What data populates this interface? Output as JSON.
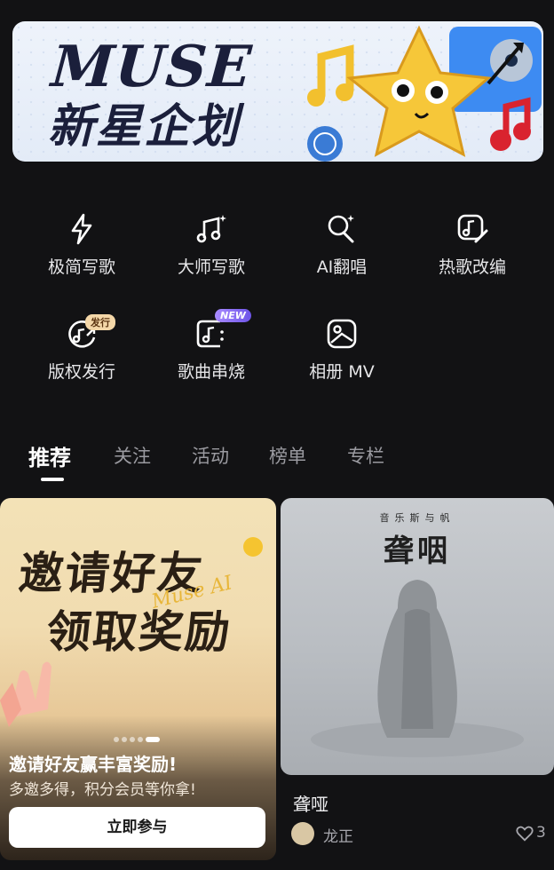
{
  "banner": {
    "title": "MUSE",
    "subtitle": "新星企划"
  },
  "tools": [
    {
      "label": "极简写歌",
      "icon": "lightning-icon"
    },
    {
      "label": "大师写歌",
      "icon": "music-note-icon"
    },
    {
      "label": "AI翻唱",
      "icon": "microphone-icon"
    },
    {
      "label": "热歌改编",
      "icon": "music-edit-icon"
    },
    {
      "label": "版权发行",
      "icon": "copyright-release-icon",
      "badge": "发行"
    },
    {
      "label": "歌曲串烧",
      "icon": "music-medley-icon",
      "badge": "NEW"
    },
    {
      "label": "相册 MV",
      "icon": "photo-mv-icon"
    }
  ],
  "tabs": [
    "推荐",
    "关注",
    "活动",
    "榜单",
    "专栏"
  ],
  "active_tab": "推荐",
  "promo_card": {
    "headline_line1": "邀请好友",
    "headline_line2": "领取奖励",
    "brand_script": "Muse AI",
    "title": "邀请好友赢丰富奖励!",
    "subtitle": "多邀多得，积分会员等你拿!",
    "button": "立即参与",
    "carousel_count": 5,
    "carousel_active": 5
  },
  "song_card": {
    "cover_small": "音乐斯与帆",
    "cover_title": "聋咽",
    "title": "聋哑",
    "artist": "龙正",
    "likes": "3"
  },
  "colors": {
    "background": "#121214",
    "banner_bg": "#e3ebf7",
    "badge_new": "#7b5cf0",
    "badge_release": "#f4d7a8"
  }
}
